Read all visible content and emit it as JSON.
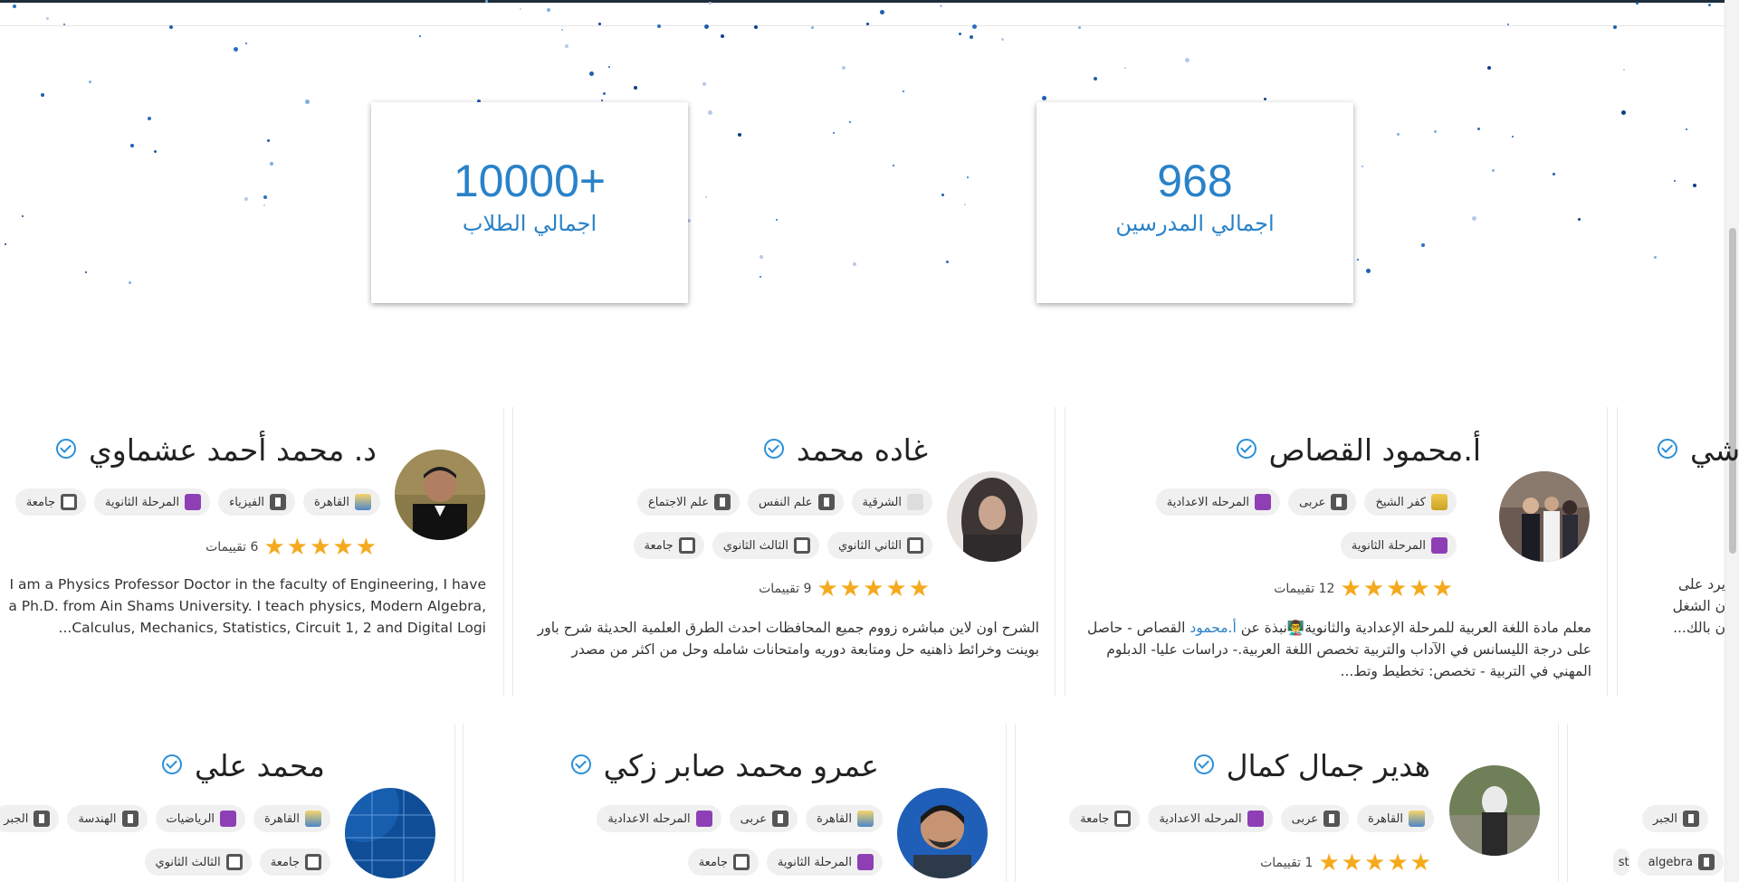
{
  "stats": [
    {
      "value": "10000+",
      "label": "اجمالي الطلاب"
    },
    {
      "value": "968",
      "label": "اجمالي المدرسين"
    }
  ],
  "colors": {
    "accent": "#2a82c8",
    "star": "#f5a91c",
    "chip_bg": "#f0f0f0"
  },
  "teachers_row1": [
    {
      "name": "أ.محمود القصاص",
      "chips": [
        "كفر الشيخ",
        "عربى",
        "المرحله الاعدادية",
        "المرحلة الثانوية"
      ],
      "rating": 5,
      "reviews": "12 تقييمات",
      "bio_prefix": "معلم مادة اللغة العربية للمرحلة الإعدادية والثانوية👨‍🏫نبذة عن ",
      "bio_link": "أ.محمود",
      "bio_suffix": " القصاص - حاصل على درجة الليسانس في الآداب والتربية تخصص اللغة العربية.- دراسات عليا- الدبلوم المهني في التربية - تخصص: تخطيط وتط..."
    },
    {
      "name": "غاده محمد",
      "chips": [
        "الشرقية",
        "علم النفس",
        "علم الاجتماع",
        "الثاني الثانوي",
        "الثالث الثانوي",
        "جامعة"
      ],
      "rating": 5,
      "reviews": "9 تقييمات",
      "bio": "الشرح اون لاين مباشره زووم جميع المحافظات احدث الطرق العلمية الحديثة شرح باور بوينت وخرائط ذاهنيه حل ومتابعة دوريه وامتحانات شامله وحل من اكثر من مصدر"
    },
    {
      "name": "د. محمد أحمد عشماوي",
      "chips": [
        "القاهرة",
        "الفيزياء",
        "المرحلة الثانوية",
        "جامعة"
      ],
      "rating": 5,
      "reviews": "6 تقييمات",
      "bio": "I am a Physics Professor Doctor in the faculty of Engineering, I have a Ph.D. from Ain Shams University. I teach physics, Modern Algebra, Calculus, Mechanics, Statistics, Circuit 1, 2 and Digital Logi..."
    },
    {
      "name": "شي",
      "bio_lines": [
        "يرد على",
        "ن الشغل",
        "ن بالك..."
      ]
    }
  ],
  "teachers_row2": [
    {
      "name": "هدير جمال كمال",
      "chips": [
        "القاهرة",
        "عربى",
        "المرحله الاعدادية",
        "جامعة"
      ],
      "rating": 5,
      "reviews": "1 تقييمات"
    },
    {
      "name": "عمرو محمد صابر زكي",
      "chips": [
        "القاهرة",
        "عربى",
        "المرحله الاعدادية",
        "المرحلة الثانوية",
        "جامعة"
      ]
    },
    {
      "name": "محمد علي",
      "chips": [
        "القاهرة",
        "الرياضيات",
        "الهندسة",
        "الجبر",
        "جامعة",
        "الثالث الثانوي"
      ]
    },
    {
      "chips": [
        "الجبر",
        "algebra",
        "st"
      ]
    }
  ]
}
